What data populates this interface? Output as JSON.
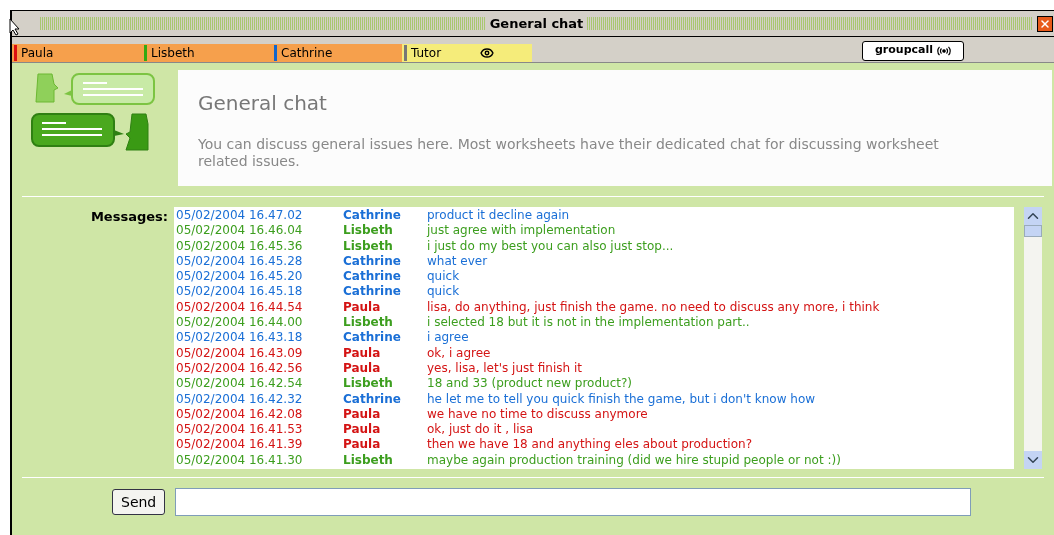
{
  "window": {
    "title": "General chat"
  },
  "tabs": [
    {
      "label": "Paula",
      "color": "#dd1111",
      "selected": false
    },
    {
      "label": "Lisbeth",
      "color": "#33aa11",
      "selected": false
    },
    {
      "label": "Cathrine",
      "color": "#1166cc",
      "selected": false
    },
    {
      "label": "Tutor",
      "color": "#777777",
      "selected": true
    }
  ],
  "groupcall_button": "groupcall",
  "header": {
    "title": "General chat",
    "description": "You can discuss general issues here. Most worksheets have their dedicated chat for discussing worksheet related issues."
  },
  "messages_label": "Messages:",
  "messages": [
    {
      "time": "05/02/2004 16.47.02",
      "sender": "Cathrine",
      "text": "product it decline again",
      "color": "#1a6fd6"
    },
    {
      "time": "05/02/2004 16.46.04",
      "sender": "Lisbeth",
      "text": "just agree with implementation",
      "color": "#3c9e1e"
    },
    {
      "time": "05/02/2004 16.45.36",
      "sender": "Lisbeth",
      "text": "i just do my best you can also just stop...",
      "color": "#3c9e1e"
    },
    {
      "time": "05/02/2004 16.45.28",
      "sender": "Cathrine",
      "text": "what ever",
      "color": "#1a6fd6"
    },
    {
      "time": "05/02/2004 16.45.20",
      "sender": "Cathrine",
      "text": "quick",
      "color": "#1a6fd6"
    },
    {
      "time": "05/02/2004 16.45.18",
      "sender": "Cathrine",
      "text": "quick",
      "color": "#1a6fd6"
    },
    {
      "time": "05/02/2004 16.44.54",
      "sender": "Paula",
      "text": "lisa, do anything, just finish the game. no need to discuss any more, i think",
      "color": "#d41414"
    },
    {
      "time": "05/02/2004 16.44.00",
      "sender": "Lisbeth",
      "text": "i selected 18 but it is not in the implementation part..",
      "color": "#3c9e1e"
    },
    {
      "time": "05/02/2004 16.43.18",
      "sender": "Cathrine",
      "text": "i agree",
      "color": "#1a6fd6"
    },
    {
      "time": "05/02/2004 16.43.09",
      "sender": "Paula",
      "text": "ok, i agree",
      "color": "#d41414"
    },
    {
      "time": "05/02/2004 16.42.56",
      "sender": "Paula",
      "text": "yes, lisa, let's just finish it",
      "color": "#d41414"
    },
    {
      "time": "05/02/2004 16.42.54",
      "sender": "Lisbeth",
      "text": "18 and 33 (product new product?)",
      "color": "#3c9e1e"
    },
    {
      "time": "05/02/2004 16.42.32",
      "sender": "Cathrine",
      "text": "he let me to tell you quick finish the game, but i don't know how",
      "color": "#1a6fd6"
    },
    {
      "time": "05/02/2004 16.42.08",
      "sender": "Paula",
      "text": "we have no time to discuss anymore",
      "color": "#d41414"
    },
    {
      "time": "05/02/2004 16.41.53",
      "sender": "Paula",
      "text": "ok, just do it , lisa",
      "color": "#d41414"
    },
    {
      "time": "05/02/2004 16.41.39",
      "sender": "Paula",
      "text": "then we have 18 and anything eles about production?",
      "color": "#d41414"
    },
    {
      "time": "05/02/2004 16.41.30",
      "sender": "Lisbeth",
      "text": "maybe again production training (did we hire stupid people or not :))",
      "color": "#3c9e1e"
    }
  ],
  "send_button": "Send"
}
